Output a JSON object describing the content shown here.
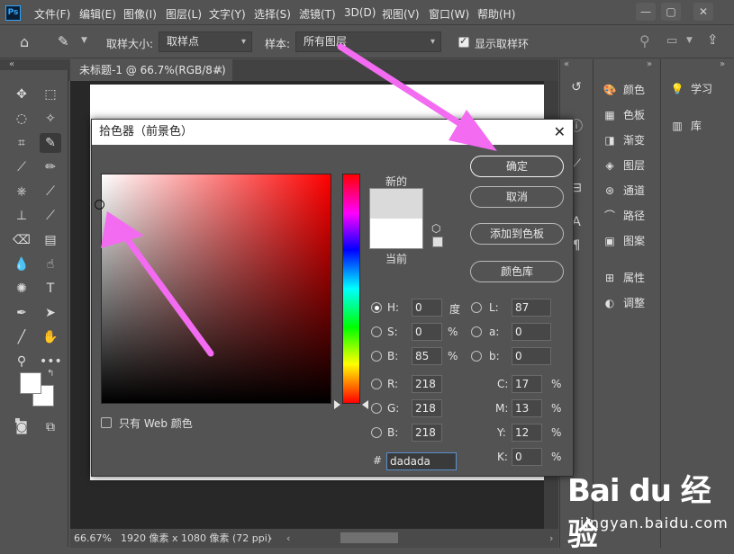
{
  "app": {
    "logo": "Ps",
    "menus": [
      "文件(F)",
      "编辑(E)",
      "图像(I)",
      "图层(L)",
      "文字(Y)",
      "选择(S)",
      "滤镜(T)",
      "3D(D)",
      "视图(V)",
      "窗口(W)",
      "帮助(H)"
    ]
  },
  "options_bar": {
    "sample_size_label": "取样大小:",
    "sample_size_value": "取样点",
    "sample_label": "样本:",
    "sample_value": "所有图层",
    "show_ring_label": "显示取样环",
    "show_ring_checked": true
  },
  "document": {
    "tab_title": "未标题-1 @ 66.7%(RGB/8#)",
    "zoom": "66.67%",
    "info": "1920 像素 x 1080 像素 (72 ppi)"
  },
  "panels": {
    "mid": [
      {
        "icon": "palette-icon",
        "label": "颜色"
      },
      {
        "icon": "swatches-icon",
        "label": "色板"
      },
      {
        "icon": "gradient-icon",
        "label": "渐变"
      },
      {
        "icon": "layers-icon",
        "label": "图层"
      },
      {
        "icon": "channels-icon",
        "label": "通道"
      },
      {
        "icon": "paths-icon",
        "label": "路径"
      },
      {
        "icon": "patterns-icon",
        "label": "图案"
      },
      {
        "icon": "properties-icon",
        "label": "属性"
      },
      {
        "icon": "adjustments-icon",
        "label": "调整"
      }
    ],
    "right": [
      {
        "icon": "lightbulb-icon",
        "label": "学习"
      },
      {
        "icon": "library-icon",
        "label": "库"
      }
    ]
  },
  "dialog": {
    "title": "拾色器（前景色）",
    "label_new": "新的",
    "label_current": "当前",
    "new_color": "#dadada",
    "current_color": "#ffffff",
    "buttons": {
      "ok": "确定",
      "cancel": "取消",
      "add_swatch": "添加到色板",
      "color_library": "颜色库"
    },
    "web_only_label": "只有 Web 颜色",
    "hsb": {
      "h_label": "H:",
      "h": "0",
      "h_unit": "度",
      "s_label": "S:",
      "s": "0",
      "s_unit": "%",
      "b_label": "B:",
      "b": "85",
      "b_unit": "%"
    },
    "lab": {
      "l_label": "L:",
      "l": "87",
      "a_label": "a:",
      "a": "0",
      "b_label": "b:",
      "b": "0"
    },
    "rgb": {
      "r_label": "R:",
      "r": "218",
      "g_label": "G:",
      "g": "218",
      "b_label": "B:",
      "b": "218"
    },
    "cmyk": {
      "c_label": "C:",
      "c": "17",
      "c_unit": "%",
      "m_label": "M:",
      "m": "13",
      "m_unit": "%",
      "y_label": "Y:",
      "y": "12",
      "y_unit": "%",
      "k_label": "K:",
      "k": "0",
      "k_unit": "%"
    },
    "hex_label": "#",
    "hex": "dadada"
  },
  "annotation_color": "#f26bf0",
  "watermark": {
    "logo": "Bai du 经验",
    "url": "jingyan.baidu.com"
  }
}
